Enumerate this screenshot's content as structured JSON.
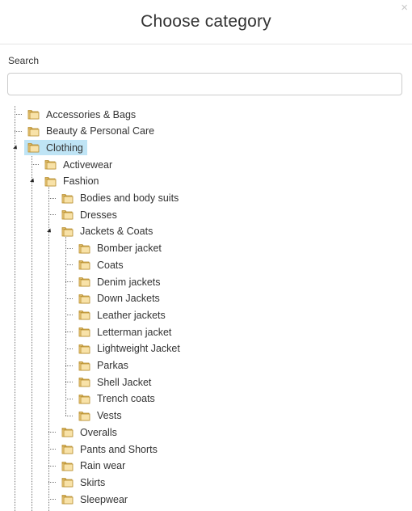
{
  "dialog": {
    "title": "Choose category",
    "close_glyph": "×"
  },
  "search": {
    "label": "Search",
    "value": "",
    "placeholder": ""
  },
  "tree": {
    "selected": "Clothing",
    "nodes": [
      {
        "label": "Accessories & Bags",
        "level": 0,
        "expanded": false
      },
      {
        "label": "Beauty & Personal Care",
        "level": 0,
        "expanded": false
      },
      {
        "label": "Clothing",
        "level": 0,
        "expanded": true,
        "selected": true
      },
      {
        "label": "Activewear",
        "level": 1,
        "expanded": false
      },
      {
        "label": "Fashion",
        "level": 1,
        "expanded": true
      },
      {
        "label": "Bodies and body suits",
        "level": 2,
        "expanded": false
      },
      {
        "label": "Dresses",
        "level": 2,
        "expanded": false
      },
      {
        "label": "Jackets & Coats",
        "level": 2,
        "expanded": true
      },
      {
        "label": "Bomber jacket",
        "level": 3,
        "expanded": false
      },
      {
        "label": "Coats",
        "level": 3,
        "expanded": false
      },
      {
        "label": "Denim jackets",
        "level": 3,
        "expanded": false
      },
      {
        "label": "Down Jackets",
        "level": 3,
        "expanded": false
      },
      {
        "label": "Leather jackets",
        "level": 3,
        "expanded": false
      },
      {
        "label": "Letterman jacket",
        "level": 3,
        "expanded": false
      },
      {
        "label": "Lightweight Jacket",
        "level": 3,
        "expanded": false
      },
      {
        "label": "Parkas",
        "level": 3,
        "expanded": false
      },
      {
        "label": "Shell Jacket",
        "level": 3,
        "expanded": false
      },
      {
        "label": "Trench coats",
        "level": 3,
        "expanded": false
      },
      {
        "label": "Vests",
        "level": 3,
        "expanded": false
      },
      {
        "label": "Overalls",
        "level": 2,
        "expanded": false
      },
      {
        "label": "Pants and Shorts",
        "level": 2,
        "expanded": false
      },
      {
        "label": "Rain wear",
        "level": 2,
        "expanded": false
      },
      {
        "label": "Skirts",
        "level": 2,
        "expanded": false
      },
      {
        "label": "Sleepwear",
        "level": 2,
        "expanded": false
      }
    ]
  },
  "icons": {
    "node_icon": "folder-icon",
    "expanded_marker": "triangle-expanded-icon"
  },
  "colors": {
    "selected_bg": "#bfe4f5",
    "folder_fill": "#f3d48a",
    "folder_stroke": "#b58a2a",
    "text": "#333333",
    "border": "#cccccc"
  }
}
